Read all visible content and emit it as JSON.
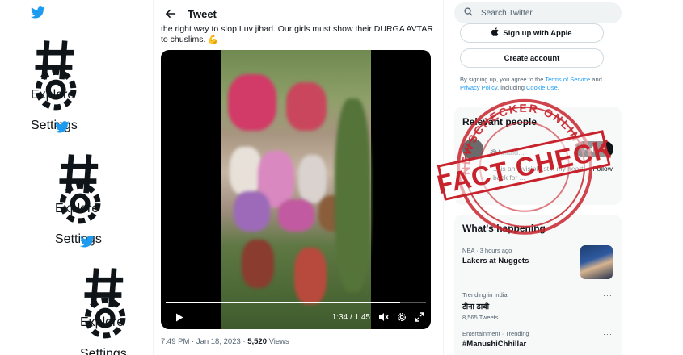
{
  "nav": {
    "items": [
      {
        "explore": "Explore",
        "settings": "Settings"
      },
      {
        "explore": "Explore",
        "settings": "Settings"
      },
      {
        "explore": "Explore",
        "settings": "Settings"
      }
    ]
  },
  "tweet": {
    "header_title": "Tweet",
    "text": "the right way to stop Luv jihad. Our girls must show their DURGA AVTAR to chuslims. 💪",
    "video": {
      "time_display": "1:34 / 1:45",
      "progress_fraction": 0.9
    },
    "meta": {
      "time": "7:49 PM · Jan 18, 2023 · ",
      "views_count": "5,520",
      "views_label": " Views"
    }
  },
  "sidebar": {
    "search_placeholder": "Search Twitter",
    "signup_apple": "Sign up with Apple",
    "create_account": "Create account",
    "legal_prefix": "By signing up, you agree to the ",
    "legal_terms": "Terms of Service",
    "legal_and": " and ",
    "legal_privacy": "Privacy Policy",
    "legal_mid": ", including ",
    "legal_cookie": "Cookie Use",
    "legal_end": ".",
    "relevant_title": "Relevant people",
    "relevant_handle": "@Anand...",
    "relevant_bio": "... is an invisible st... my heart ... Follow back for ...",
    "follow_label": "Follow",
    "trends_title": "What's happening",
    "trends": [
      {
        "context": "NBA · 3 hours ago",
        "name": "Lakers at Nuggets",
        "count": ""
      },
      {
        "context": "Trending in India",
        "name": "टीना डाबी",
        "count": "8,565 Tweets"
      },
      {
        "context": "Entertainment · Trending",
        "name": "#ManushiChhillar",
        "count": ""
      }
    ],
    "more_label": "···"
  },
  "stamp": {
    "top_text": "NEWSCHECKER ONLINE",
    "main_text": "FACT CHECK"
  },
  "colors": {
    "accent": "#1d9bf0",
    "stamp": "#c8232c",
    "text": "#0f1419",
    "muted": "#536471"
  }
}
